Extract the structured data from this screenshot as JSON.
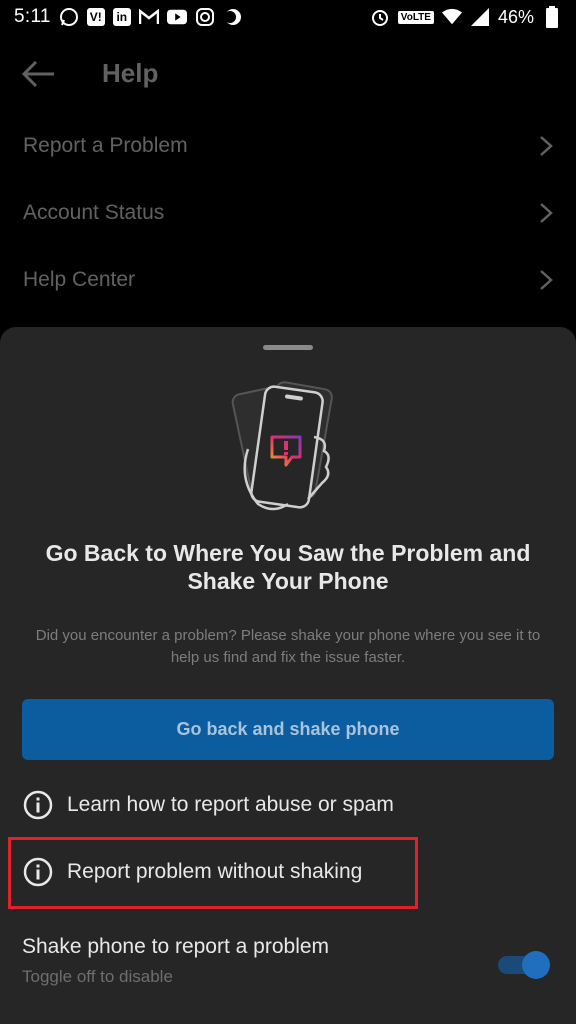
{
  "status_bar": {
    "time": "5:11",
    "battery_percent": "46%",
    "network_badge": "VoLTE",
    "notification_icons": [
      "whatsapp-icon",
      "vi-icon",
      "linkedin-icon",
      "gmail-icon",
      "youtube-icon",
      "instagram-icon",
      "moon-icon"
    ],
    "system_icons": [
      "alarm-icon",
      "volte-icon",
      "wifi-icon",
      "signal-icon",
      "battery-icon"
    ]
  },
  "header": {
    "title": "Help",
    "back_icon": "arrow-left-icon"
  },
  "menu": {
    "items": [
      {
        "label": "Report a Problem"
      },
      {
        "label": "Account Status"
      },
      {
        "label": "Help Center"
      }
    ]
  },
  "sheet": {
    "title": "Go Back to Where You Saw the Problem and Shake Your Phone",
    "description": "Did you encounter a problem? Please shake your phone where you see it to help us find and fix the issue faster.",
    "primary_button": "Go back and shake phone",
    "options": [
      {
        "label": "Learn how to report abuse or spam",
        "icon": "info-icon"
      },
      {
        "label": "Report problem without shaking",
        "icon": "info-icon"
      }
    ],
    "toggle": {
      "title": "Shake phone to report a problem",
      "subtitle": "Toggle off to disable",
      "enabled": true
    }
  },
  "colors": {
    "background": "#000000",
    "sheet": "#262626",
    "primary_button": "#0b5da0",
    "highlight_border": "#e0202a",
    "toggle_accent": "#1f6fbe"
  }
}
